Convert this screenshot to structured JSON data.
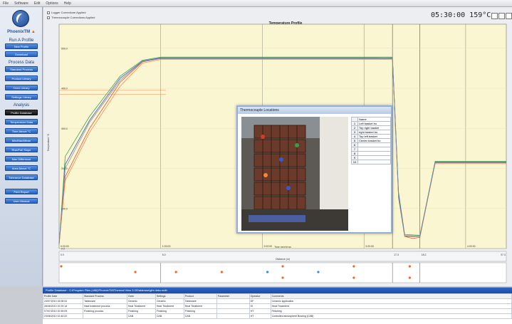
{
  "menu": [
    "File",
    "Software",
    "Edit",
    "Options",
    "Help"
  ],
  "brand": {
    "name": "PhoenixTM",
    "tm_suffix": "▲"
  },
  "sidebar": {
    "sections": [
      {
        "title": "Run A Profile",
        "items": [
          "New Profile",
          "Download"
        ]
      },
      {
        "title": "Process Data",
        "items": [
          "Standard Process",
          "Product Library",
          "Oven Library",
          "Settings Library"
        ]
      },
      {
        "title": "Analysis",
        "items": [
          "Profile Database",
          "Temperature Data",
          "Time Above °C",
          "Min/Max/Mean",
          "Rise/Fall Slope",
          "Max Difference",
          "Area Above °C",
          "Tolerance Database"
        ]
      },
      {
        "title": "",
        "items": [
          "Print Report",
          "User Manual"
        ]
      }
    ],
    "active_item": "Profile Database"
  },
  "header": {
    "check1": "Logger Correctione Applied",
    "check2": "Thermocouple Corrections Applied",
    "time_display": "05:30:00  159°C"
  },
  "chart_data": {
    "type": "line",
    "title": "Temperature Profile",
    "xlabel": "Time mm:hh:ss",
    "ylabel": "Temperature °C",
    "x_ticks": [
      "0:00:00",
      "1:00:00",
      "2:00:00",
      "3:00:00",
      "4:00:00"
    ],
    "y_ticks": [
      "0.0",
      "100.0",
      "200.0",
      "300.0",
      "400.0",
      "500.0"
    ],
    "ylim": [
      0,
      560
    ],
    "xlim": [
      0,
      4.4
    ],
    "grid": true,
    "series": [
      {
        "color": "#d9503f",
        "points": [
          [
            0,
            10
          ],
          [
            0.06,
            180
          ],
          [
            0.3,
            300
          ],
          [
            0.6,
            415
          ],
          [
            0.82,
            466
          ],
          [
            1.0,
            475
          ],
          [
            2.5,
            475
          ],
          [
            3.1,
            475
          ],
          [
            3.2,
            474
          ],
          [
            3.28,
            475
          ],
          [
            3.34,
            130
          ],
          [
            3.4,
            30
          ],
          [
            3.48,
            25
          ],
          [
            3.55,
            28
          ],
          [
            3.7,
            215
          ],
          [
            4.4,
            215
          ]
        ]
      },
      {
        "color": "#f08a4b",
        "points": [
          [
            0,
            10
          ],
          [
            0.06,
            170
          ],
          [
            0.3,
            290
          ],
          [
            0.6,
            405
          ],
          [
            0.82,
            463
          ],
          [
            1.0,
            472
          ],
          [
            3.28,
            472
          ],
          [
            3.34,
            125
          ],
          [
            3.4,
            30
          ],
          [
            3.55,
            30
          ],
          [
            3.7,
            212
          ],
          [
            4.4,
            212
          ]
        ]
      },
      {
        "color": "#3aa35a",
        "points": [
          [
            0,
            10
          ],
          [
            0.06,
            230
          ],
          [
            0.3,
            330
          ],
          [
            0.6,
            430
          ],
          [
            0.82,
            470
          ],
          [
            1.0,
            478
          ],
          [
            3.28,
            478
          ],
          [
            3.34,
            140
          ],
          [
            3.4,
            35
          ],
          [
            3.55,
            33
          ],
          [
            3.7,
            218
          ],
          [
            4.4,
            218
          ]
        ]
      },
      {
        "color": "#3c58c6",
        "points": [
          [
            0,
            10
          ],
          [
            0.06,
            210
          ],
          [
            0.3,
            320
          ],
          [
            0.6,
            425
          ],
          [
            0.82,
            468
          ],
          [
            1.0,
            476
          ],
          [
            3.28,
            476
          ],
          [
            3.34,
            135
          ],
          [
            3.4,
            32
          ],
          [
            3.55,
            31
          ],
          [
            3.7,
            216
          ],
          [
            4.4,
            216
          ]
        ]
      },
      {
        "color": "#8a8fa0",
        "points": [
          [
            0,
            10
          ],
          [
            0.06,
            200
          ],
          [
            0.3,
            315
          ],
          [
            0.6,
            420
          ],
          [
            0.82,
            467
          ],
          [
            1.0,
            474
          ],
          [
            3.28,
            474
          ],
          [
            3.34,
            128
          ],
          [
            3.4,
            31
          ],
          [
            3.55,
            30
          ],
          [
            3.7,
            214
          ],
          [
            4.4,
            214
          ]
        ]
      }
    ],
    "reference_lines": [
      395,
      385
    ],
    "distance": {
      "label": "Distance (m)",
      "ticks": [
        "0.0",
        "5.0",
        "17.3",
        "18.2",
        "37.3"
      ]
    }
  },
  "modal": {
    "title": "Thermocouple Locations",
    "table_header": "Name",
    "rows": [
      {
        "n": "1",
        "name": "Left basket bo"
      },
      {
        "n": "2",
        "name": "Top right basket"
      },
      {
        "n": "3",
        "name": "right basket bo"
      },
      {
        "n": "4",
        "name": "Top left basket"
      },
      {
        "n": "5",
        "name": "Center basket bo"
      },
      {
        "n": "6",
        "name": ""
      },
      {
        "n": "7",
        "name": ""
      },
      {
        "n": "8",
        "name": ""
      },
      {
        "n": "9",
        "name": ""
      },
      {
        "n": "10",
        "name": ""
      }
    ]
  },
  "database": {
    "title": "Profile Database - C:\\Program Files (x86)\\PhoenixTM\\Thermal View 3.0\\Database\\gfm data.mdb",
    "columns": [
      "Profile Date",
      "Standard Process",
      "Oven",
      "Settings",
      "Product",
      "Parameter",
      "Operator",
      "Comments"
    ],
    "rows": [
      [
        "24/07/2010 15:08:04",
        "Tableware",
        "Ceramic",
        "Ceramic",
        "Tableware",
        "",
        "DF",
        "Ceramic application"
      ],
      [
        "26/06/2010 10:29:14",
        "Heat treatment process",
        "Heat Treatment",
        "Heat Treatment",
        "Heat Treatment",
        "",
        "SI",
        "Heat Treatment"
      ],
      [
        "07/07/2010 10:39:09",
        "Finishing process",
        "Finishing",
        "Finishing",
        "Finishing",
        "",
        "HT",
        "Finishing"
      ],
      [
        "23/06/2010 12:40:22",
        "",
        "CAB",
        "CAB",
        "CAB",
        "",
        "HT",
        "Controlled atmosphere Brazing (CAB)"
      ]
    ]
  }
}
